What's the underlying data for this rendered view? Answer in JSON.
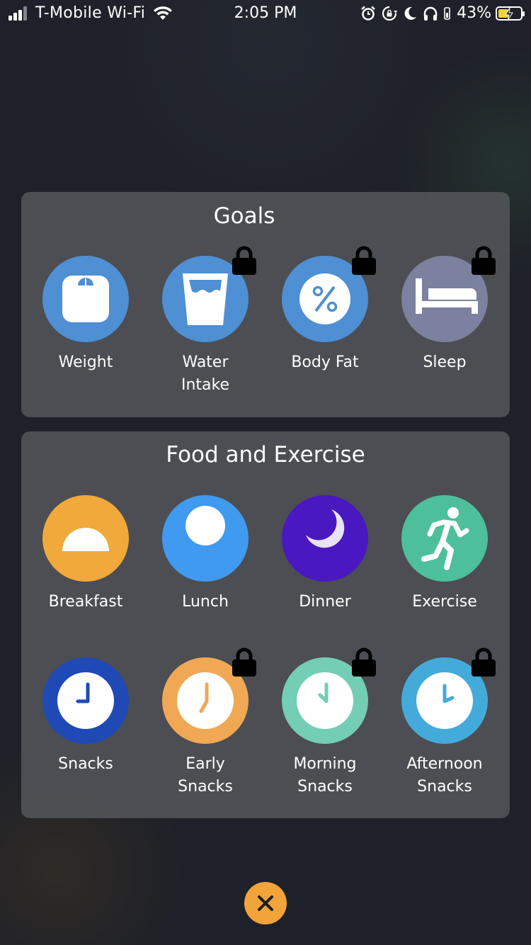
{
  "status_bar": {
    "carrier": "T-Mobile Wi-Fi",
    "time": "2:05 PM",
    "battery_percent": "43%",
    "icons": [
      "signal-icon",
      "wifi-icon",
      "alarm-icon",
      "rotation-lock-icon",
      "moon-icon",
      "headphones-icon",
      "battery-icon"
    ]
  },
  "goals": {
    "title": "Goals",
    "items": [
      {
        "label": "Weight",
        "icon": "scale-icon",
        "color": "#4f8fd4",
        "locked": false
      },
      {
        "label": "Water\nIntake",
        "line1": "Water",
        "line2": "Intake",
        "icon": "water-glass-icon",
        "color": "#4f8fd4",
        "locked": true
      },
      {
        "label": "Body Fat",
        "icon": "percent-icon",
        "color": "#4f8fd4",
        "locked": true
      },
      {
        "label": "Sleep",
        "icon": "bed-icon",
        "color": "#7b819e",
        "locked": true
      }
    ]
  },
  "food_exercise": {
    "title": "Food and Exercise",
    "items": [
      {
        "label": "Breakfast",
        "icon": "sunrise-icon",
        "color": "#f0a93a",
        "locked": false
      },
      {
        "label": "Lunch",
        "icon": "sun-icon",
        "color": "#3f9af0",
        "locked": false
      },
      {
        "label": "Dinner",
        "icon": "moon-icon",
        "color": "#4a18c0",
        "locked": false
      },
      {
        "label": "Exercise",
        "icon": "running-person-icon",
        "color": "#4dbf9a",
        "locked": false
      },
      {
        "label": "Snacks",
        "icon": "clock-icon",
        "color": "#1f49b5",
        "locked": false
      },
      {
        "line1": "Early",
        "line2": "Snacks",
        "icon": "clock-icon",
        "color": "#f0a855",
        "locked": true
      },
      {
        "line1": "Morning",
        "line2": "Snacks",
        "icon": "clock-icon",
        "color": "#74cdb5",
        "locked": true
      },
      {
        "line1": "Afternoon",
        "line2": "Snacks",
        "icon": "clock-icon",
        "color": "#44aad9",
        "locked": true
      }
    ]
  },
  "close_button": {
    "icon": "close-icon",
    "color": "#f2a33a"
  }
}
